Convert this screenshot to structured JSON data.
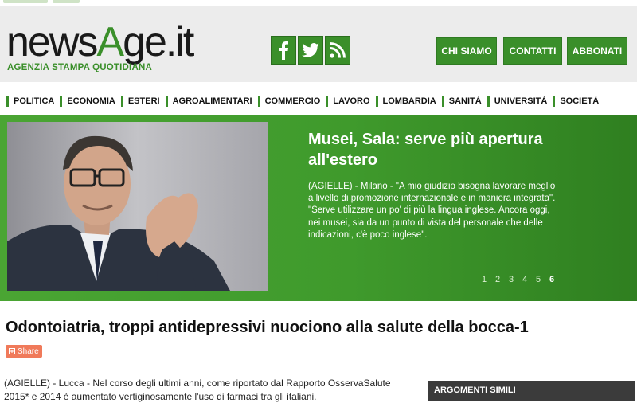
{
  "logo": {
    "text_a": "news",
    "text_b": "A",
    "text_c": "ge.it",
    "tagline": "AGENZIA STAMPA QUOTIDIANA"
  },
  "social": [
    {
      "name": "facebook-icon",
      "glyph": "f"
    },
    {
      "name": "twitter-icon",
      "glyph": "t"
    },
    {
      "name": "rss-icon",
      "glyph": "rss"
    }
  ],
  "header_buttons": [
    "CHI SIAMO",
    "CONTATTI",
    "ABBONATI"
  ],
  "nav": [
    "POLITICA",
    "ECONOMIA",
    "ESTERI",
    "AGROALIMENTARI",
    "COMMERCIO",
    "LAVORO",
    "LOMBARDIA",
    "SANITÀ",
    "UNIVERSITÀ",
    "SOCIETÀ"
  ],
  "hero": {
    "title": "Musei, Sala: serve più apertura all'estero",
    "description": "(AGIELLE) - Milano - \"A mio giudizio bisogna lavorare meglio a livello di promozione internazionale e in maniera integrata\". \"Serve utilizzare un po' di più la lingua inglese. Ancora oggi, nei musei, sia da un punto di vista del personale che delle indicazioni, c'è poco inglese\".",
    "pages": [
      "1",
      "2",
      "3",
      "4",
      "5",
      "6"
    ],
    "active_page": "6"
  },
  "article": {
    "title": "Odontoiatria, troppi antidepressivi nuociono alla salute della bocca-1",
    "share_label": "Share",
    "body": "(AGIELLE) - Lucca - Nel corso degli ultimi anni, come riportato dal Rapporto OsservaSalute 2015* e 2014 è aumentato vertiginosamente l'uso di farmaci tra gli italiani."
  },
  "sidebar": {
    "heading": "ARGOMENTI SIMILI"
  },
  "colors": {
    "brand_green": "#3a8f2a",
    "share_orange": "#f07a5a",
    "sidebar_dark": "#3b3b3b"
  }
}
